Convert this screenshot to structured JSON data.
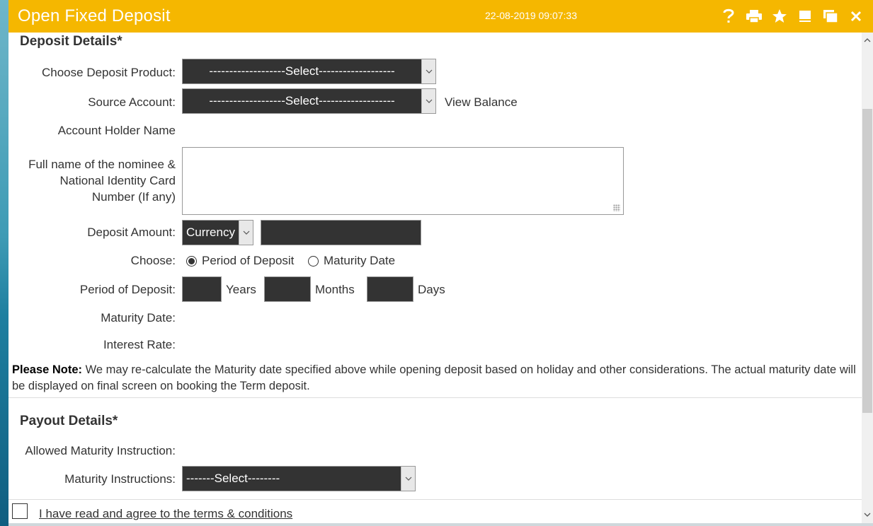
{
  "window": {
    "title": "Open Fixed Deposit",
    "datetime": "22-08-2019 09:07:33",
    "icons": [
      "help-icon",
      "print-icon",
      "star-icon",
      "minimize-icon",
      "restore-icon",
      "close-icon"
    ]
  },
  "deposit": {
    "heading": "Deposit Details*",
    "product_label": "Choose Deposit Product:",
    "product_value": "-------------------Select-------------------",
    "source_label": "Source Account:",
    "source_value": "-------------------Select-------------------",
    "view_balance": "View Balance",
    "holder_label": "Account Holder Name",
    "nominee_label_1": "Full name of the nominee &",
    "nominee_label_2": "National Identity Card",
    "nominee_label_3": "Number (If any)",
    "nominee_value": "",
    "amount_label": "Deposit Amount:",
    "currency_value": "Currency",
    "amount_value": "",
    "choose_label": "Choose:",
    "option_period": "Period of Deposit",
    "option_maturity": "Maturity Date",
    "selected_option": "Period of Deposit",
    "period_label": "Period of Deposit:",
    "years_label": "Years",
    "months_label": "Months",
    "days_label": "Days",
    "years_value": "",
    "months_value": "",
    "days_value": "",
    "maturity_label": "Maturity Date:",
    "interest_label": "Interest Rate:"
  },
  "note": {
    "prefix": "Please Note:",
    "text": " We may re-calculate the Maturity date specified above while opening deposit based on holiday and other considerations. The actual maturity date will be displayed on final screen on booking the Term deposit."
  },
  "payout": {
    "heading": "Payout Details*",
    "allowed_label": "Allowed Maturity Instruction:",
    "instructions_label": "Maturity Instructions:",
    "instructions_value": "-------Select--------"
  },
  "terms": {
    "checked": false,
    "text": "I have read and agree to the terms & conditions"
  },
  "colors": {
    "titlebar": "#f5b700",
    "field_dark": "#333333"
  }
}
